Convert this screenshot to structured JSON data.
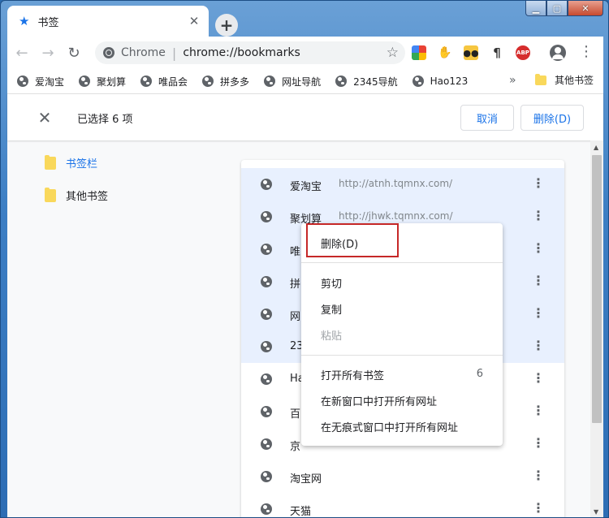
{
  "tab": {
    "title": "书签"
  },
  "toolbar": {
    "omni_label": "Chrome",
    "omni_url": "chrome://bookmarks"
  },
  "bookmarks_bar": {
    "items": [
      "爱淘宝",
      "聚划算",
      "唯品会",
      "拼多多",
      "网址导航",
      "2345导航",
      "Hao123"
    ],
    "more": "»",
    "other": "其他书签"
  },
  "selection": {
    "text": "已选择 6 项",
    "cancel": "取消",
    "delete": "删除(D)"
  },
  "sidebar": {
    "items": [
      "书签栏",
      "其他书签"
    ]
  },
  "list": {
    "rows": [
      {
        "title": "爱淘宝",
        "url": "http://atnh.tqmnx.com/"
      },
      {
        "title": "聚划算",
        "url": "http://jhwk.tqmnx.com/"
      },
      {
        "title": "唯",
        "url": ""
      },
      {
        "title": "拼",
        "url": ""
      },
      {
        "title": "网",
        "url": ""
      },
      {
        "title": "23",
        "url": ""
      },
      {
        "title": "Ha",
        "url": ""
      },
      {
        "title": "百",
        "url": ""
      },
      {
        "title": "京",
        "url": ""
      },
      {
        "title": "淘宝网",
        "url": ""
      },
      {
        "title": "天猫",
        "url": ""
      }
    ]
  },
  "context_menu": {
    "delete": "删除(D)",
    "cut": "剪切",
    "copy": "复制",
    "paste": "粘贴",
    "open_all": "打开所有书签",
    "open_all_count": "6",
    "open_new_window": "在新窗口中打开所有网址",
    "open_incognito": "在无痕式窗口中打开所有网址"
  },
  "colors": {
    "accent": "#1a73e8",
    "selected_row": "#e8f0fe",
    "highlight_box": "#c62828"
  }
}
